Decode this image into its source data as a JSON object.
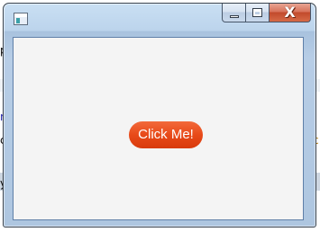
{
  "background": {
    "fragments": [
      "p",
      "n",
      "c",
      "y",
      "c"
    ]
  },
  "window": {
    "title": "",
    "icon": "app-window-icon",
    "caption_buttons": {
      "minimize_icon": "minimize-icon",
      "maximize_icon": "maximize-icon",
      "close_symbol": "X"
    }
  },
  "content": {
    "button_label": "Click Me!",
    "button_color": "#e84a19"
  }
}
